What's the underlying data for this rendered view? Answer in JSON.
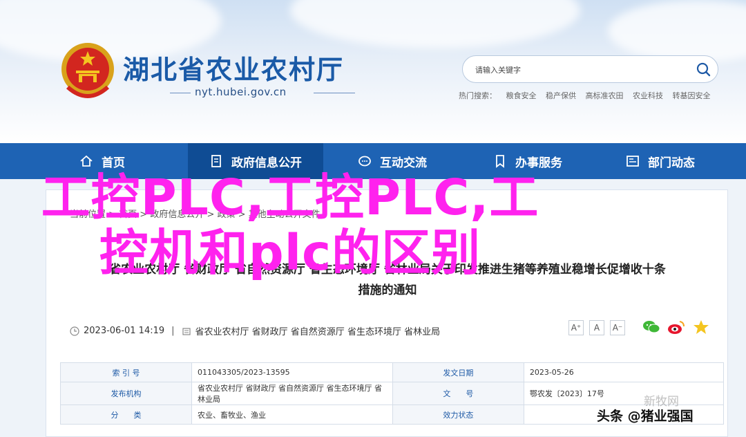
{
  "header": {
    "site_title": "湖北省农业农村厅",
    "domain": "nyt.hubei.gov.cn",
    "search_placeholder": "请输入关键字",
    "hot_label": "热门搜索：",
    "hot_terms": [
      "粮食安全",
      "稳产保供",
      "高标准农田",
      "农业科技",
      "转基因安全"
    ]
  },
  "nav": {
    "items": [
      {
        "label": "首页",
        "icon": "home-icon"
      },
      {
        "label": "政府信息公开",
        "icon": "document-icon",
        "active": true
      },
      {
        "label": "互动交流",
        "icon": "chat-icon"
      },
      {
        "label": "办事服务",
        "icon": "bookmark-icon"
      },
      {
        "label": "部门动态",
        "icon": "news-icon"
      }
    ]
  },
  "article": {
    "breadcrumb": "当前位置 > 首页 > 政府信息公开 > 政策 > 其他主动公开文件",
    "title_line1": "省农业农村厅 省财政厅 省自然资源厅 省生态环境厅 省林业局关于印发推进生猪等养殖业稳增长促增收十条",
    "title_line2": "措施的通知",
    "date": "2023-06-01 14:19",
    "source": "省农业农村厅 省财政厅 省自然资源厅 省生态环境厅 省林业局",
    "font_buttons": [
      "A⁺",
      "A",
      "A⁻"
    ],
    "info_table": [
      {
        "k1": "索 引 号",
        "v1": "011043305/2023-13595",
        "k2": "发文日期",
        "v2": "2023-05-26"
      },
      {
        "k1": "发布机构",
        "v1": "省农业农村厅 省财政厅 省自然资源厅 省生态环境厅 省林业局",
        "k2": "文　　号",
        "v2": "鄂农发〔2023〕17号"
      },
      {
        "k1": "分　　类",
        "v1": "农业、畜牧业、渔业",
        "k2": "效力状态",
        "v2": ""
      }
    ]
  },
  "overlay": {
    "title": "工控PLC,工控PLC,工控机和plc的区别",
    "watermark_logo": "新牧网",
    "watermark": "头条 @猪业强国"
  },
  "colors": {
    "nav_bg": "#1e63b4",
    "nav_active": "#0f4c94",
    "title_blue": "#1a5aa7",
    "overlay_magenta": "#ff22ee"
  }
}
